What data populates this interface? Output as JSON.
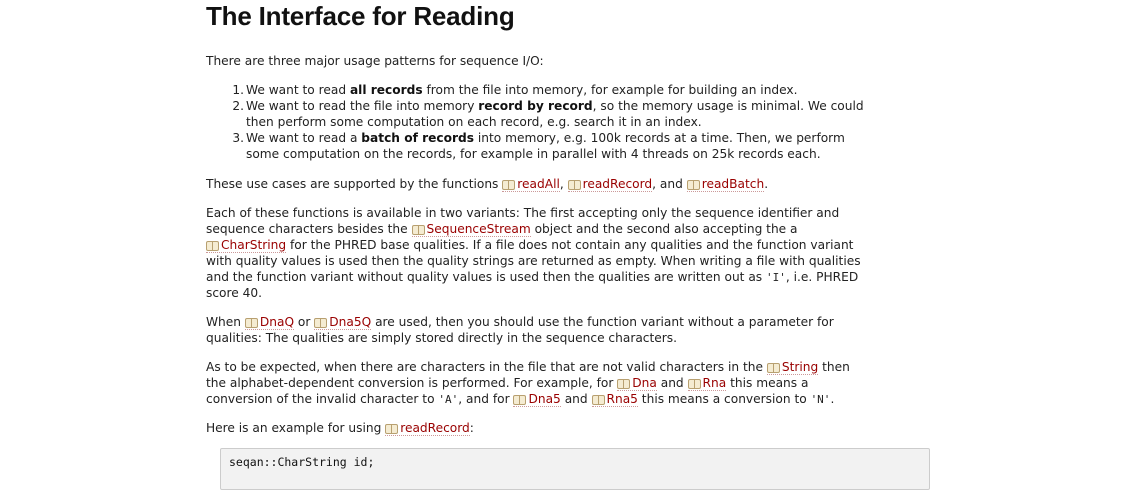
{
  "title": "The Interface for Reading",
  "intro": "There are three major usage patterns for sequence I/O:",
  "list": [
    {
      "num": "1.",
      "lines": [
        [
          {
            "t": "We want to read "
          },
          {
            "b": "all records"
          },
          {
            "t": " from the file into memory, for example for building an index."
          }
        ]
      ]
    },
    {
      "num": "2.",
      "lines": [
        [
          {
            "t": "We want to read the file into memory "
          },
          {
            "b": "record by record"
          },
          {
            "t": ", so the memory usage is minimal. We could"
          }
        ],
        [
          {
            "t": "then perform some computation on each record, e.g. search it in an index."
          }
        ]
      ]
    },
    {
      "num": "3.",
      "lines": [
        [
          {
            "t": "We want to read a "
          },
          {
            "b": "batch of records"
          },
          {
            "t": " into memory, e.g. 100k records at a time. Then, we perform"
          }
        ],
        [
          {
            "t": "some computation on the records, for example in parallel with 4 threads on 25k records each."
          }
        ]
      ]
    }
  ],
  "para_functions": [
    [
      {
        "t": "These use cases are supported by the functions "
      },
      {
        "r": "readAll"
      },
      {
        "t": ", "
      },
      {
        "r": "readRecord"
      },
      {
        "t": ", and "
      },
      {
        "r": "readBatch"
      },
      {
        "t": "."
      }
    ]
  ],
  "para_variants": [
    [
      {
        "t": "Each of these functions is available in two variants: The first accepting only the sequence identifier and"
      }
    ],
    [
      {
        "t": "sequence characters besides the "
      },
      {
        "r": "SequenceStream"
      },
      {
        "t": " object and the second also accepting the a"
      }
    ],
    [
      {
        "r": "CharString"
      },
      {
        "t": " for the PHRED base qualities. If a file does not contain any qualities and the function variant"
      }
    ],
    [
      {
        "t": "with quality values is used then the quality strings are returned as empty. When writing a file with qualities"
      }
    ],
    [
      {
        "t": "and the function variant without quality values is used then the qualities are written out as "
      },
      {
        "c": "'I'"
      },
      {
        "t": ", i.e. PHRED"
      }
    ],
    [
      {
        "t": "score 40."
      }
    ]
  ],
  "para_dnaq": [
    [
      {
        "t": "When "
      },
      {
        "r": "DnaQ"
      },
      {
        "t": " or "
      },
      {
        "r": "Dna5Q"
      },
      {
        "t": " are used, then you should use the function variant without a parameter for"
      }
    ],
    [
      {
        "t": "qualities: The qualities are simply stored directly in the sequence characters."
      }
    ]
  ],
  "para_conversion": [
    [
      {
        "t": "As to be expected, when there are characters in the file that are not valid characters in the "
      },
      {
        "r": "String"
      },
      {
        "t": " then"
      }
    ],
    [
      {
        "t": "the alphabet-dependent conversion is performed. For example, for "
      },
      {
        "r": "Dna"
      },
      {
        "t": " and "
      },
      {
        "r": "Rna"
      },
      {
        "t": " this means a"
      }
    ],
    [
      {
        "t": "conversion of the invalid character to "
      },
      {
        "c": "'A'"
      },
      {
        "t": ", and for "
      },
      {
        "r": "Dna5"
      },
      {
        "t": " and "
      },
      {
        "r": "Rna5"
      },
      {
        "t": " this means a conversion to "
      },
      {
        "c": "'N'"
      },
      {
        "t": "."
      }
    ]
  ],
  "para_example": [
    [
      {
        "t": "Here is an example for using "
      },
      {
        "r": "readRecord"
      },
      {
        "t": ":"
      }
    ]
  ],
  "code_line": "seqan::CharString id;"
}
